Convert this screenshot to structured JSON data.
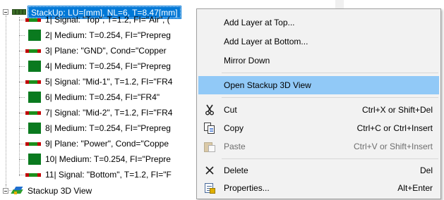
{
  "tree": {
    "root_label": "StackUp: LU=[mm], NL=6, T=8.47[mm]",
    "layers": [
      {
        "text": "1| Signal: \"Top\", T=1.2, FI=\"Air\", (",
        "kind": "signal"
      },
      {
        "text": "2| Medium: T=0.254, FI=\"Prepreg",
        "kind": "medium"
      },
      {
        "text": "3| Plane: \"GND\", Cond=\"Copper",
        "kind": "signal"
      },
      {
        "text": "4| Medium: T=0.254, FI=\"Prepreg",
        "kind": "medium"
      },
      {
        "text": "5| Signal: \"Mid-1\", T=1.2, FI=\"FR4",
        "kind": "signal"
      },
      {
        "text": "6| Medium: T=0.254, FI=\"FR4\"",
        "kind": "medium"
      },
      {
        "text": "7| Signal: \"Mid-2\", T=1.2, FI=\"FR4",
        "kind": "signal"
      },
      {
        "text": "8| Medium: T=0.254, FI=\"Prepreg",
        "kind": "medium"
      },
      {
        "text": "9| Plane: \"Power\", Cond=\"Coppe",
        "kind": "signal"
      },
      {
        "text": "10| Medium: T=0.254, FI=\"Prepre",
        "kind": "medium"
      },
      {
        "text": "11| Signal: \"Bottom\", T=1.2, FI=\"F",
        "kind": "signal"
      }
    ],
    "view_label": "Stackup 3D View"
  },
  "menu": {
    "add_top": "Add Layer at Top...",
    "add_bottom": "Add Layer at Bottom...",
    "mirror_down": "Mirror Down",
    "open_3d": "Open Stackup 3D View",
    "cut": "Cut",
    "cut_shortcut": "Ctrl+X or Shift+Del",
    "copy": "Copy",
    "copy_shortcut": "Ctrl+C or Ctrl+Insert",
    "paste": "Paste",
    "paste_shortcut": "Ctrl+V or Shift+Insert",
    "delete": "Delete",
    "delete_shortcut": "Del",
    "properties": "Properties...",
    "properties_shortcut": "Alt+Enter"
  },
  "icons": {
    "cut": "scissors-icon",
    "copy": "copy-icon",
    "paste": "paste-icon",
    "delete": "delete-x-icon",
    "properties": "properties-icon"
  },
  "colors": {
    "selection": "#0078d7",
    "menu_highlight": "#91c9f7",
    "layer_green": "#0a7a1f",
    "signal_red": "#c00000"
  }
}
